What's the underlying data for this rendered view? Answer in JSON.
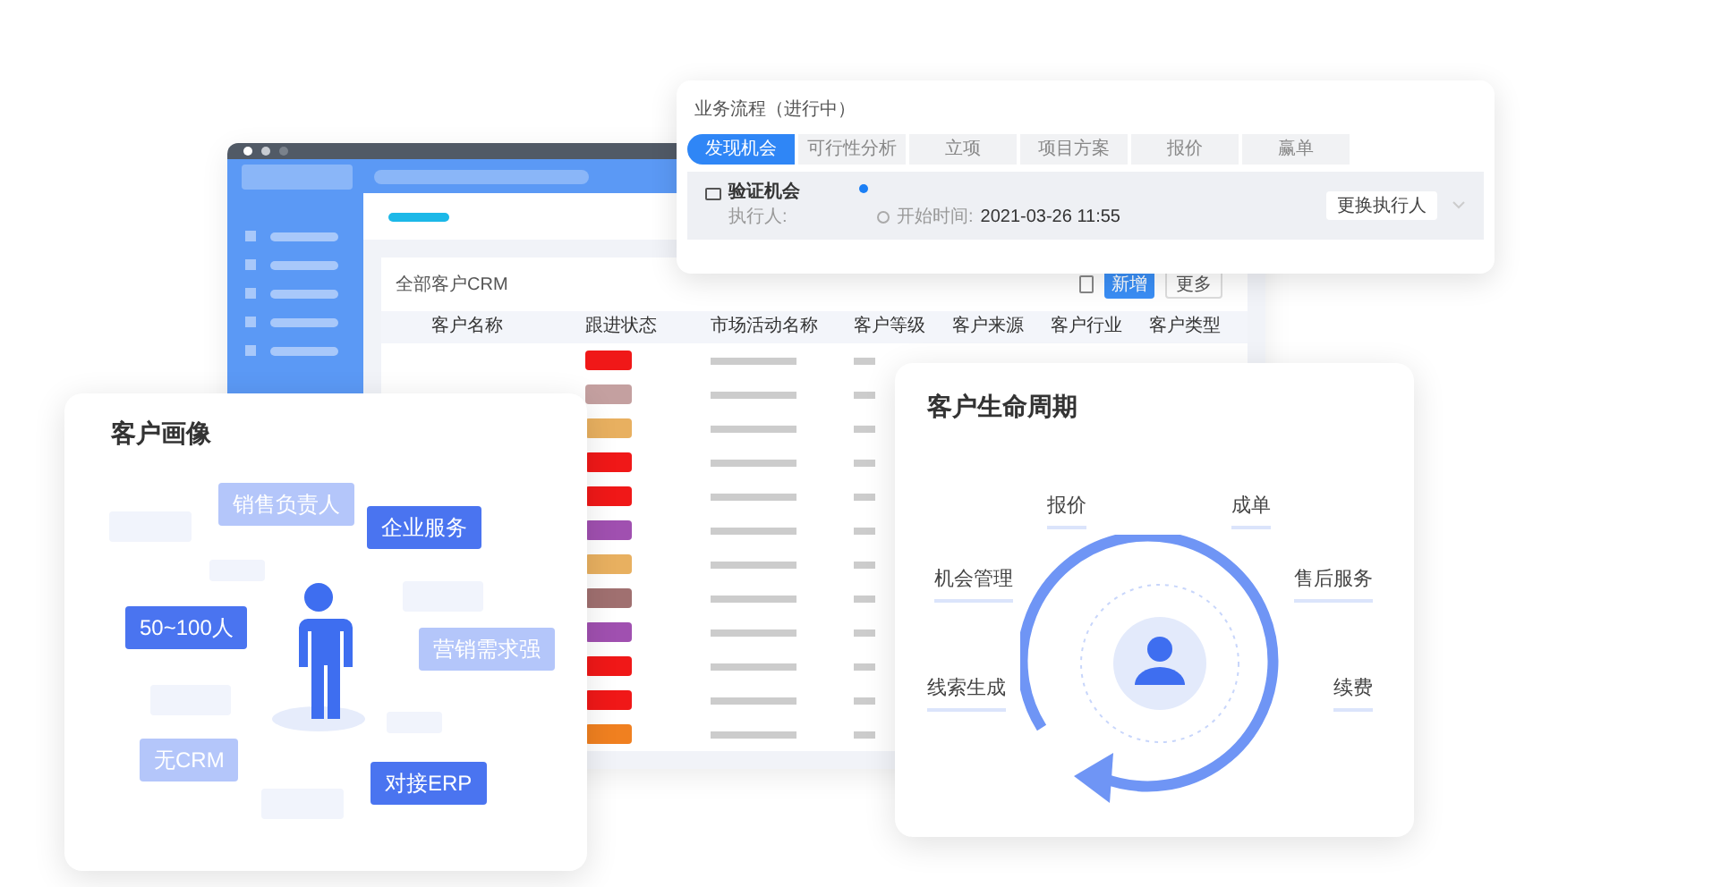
{
  "crm_window": {
    "table": {
      "title": "全部客户CRM",
      "new_button": "新增",
      "more_button": "更多",
      "columns": [
        "客户名称",
        "跟进状态",
        "市场活动名称",
        "客户等级",
        "客户来源",
        "客户行业",
        "客户类型"
      ],
      "rows": [
        {
          "color": "#f01818"
        },
        {
          "color": "#c4a0a0"
        },
        {
          "color": "#e8b060"
        },
        {
          "color": "#f01818"
        },
        {
          "color": "#f01818"
        },
        {
          "color": "#a050b0"
        },
        {
          "color": "#e8b060"
        },
        {
          "color": "#a07070"
        },
        {
          "color": "#a050b0"
        },
        {
          "color": "#f01818"
        },
        {
          "color": "#f01818"
        },
        {
          "color": "#f08020"
        }
      ]
    }
  },
  "process_card": {
    "title": "业务流程（进行中）",
    "stages": [
      {
        "label": "发现机会",
        "selected": true
      },
      {
        "label": "可行性分析",
        "selected": false
      },
      {
        "label": "立项",
        "selected": false
      },
      {
        "label": "项目方案",
        "selected": false
      },
      {
        "label": "报价",
        "selected": false
      },
      {
        "label": "赢单",
        "selected": false
      }
    ],
    "task": {
      "name": "验证机会",
      "assignee_label": "执行人:",
      "start_label": "开始时间:",
      "start_time": "2021-03-26 11:55",
      "change_button": "更换执行人"
    }
  },
  "portrait_card": {
    "title": "客户画像",
    "tags": [
      {
        "label": "销售负责人",
        "kind": "pale"
      },
      {
        "label": "企业服务",
        "kind": "solid"
      },
      {
        "label": "50~100人",
        "kind": "solid"
      },
      {
        "label": "营销需求强",
        "kind": "pale"
      },
      {
        "label": "无CRM",
        "kind": "pale"
      },
      {
        "label": "对接ERP",
        "kind": "solid"
      }
    ]
  },
  "lifecycle_card": {
    "title": "客户生命周期",
    "stages": [
      "报价",
      "成单",
      "机会管理",
      "售后服务",
      "线索生成",
      "续费"
    ]
  }
}
